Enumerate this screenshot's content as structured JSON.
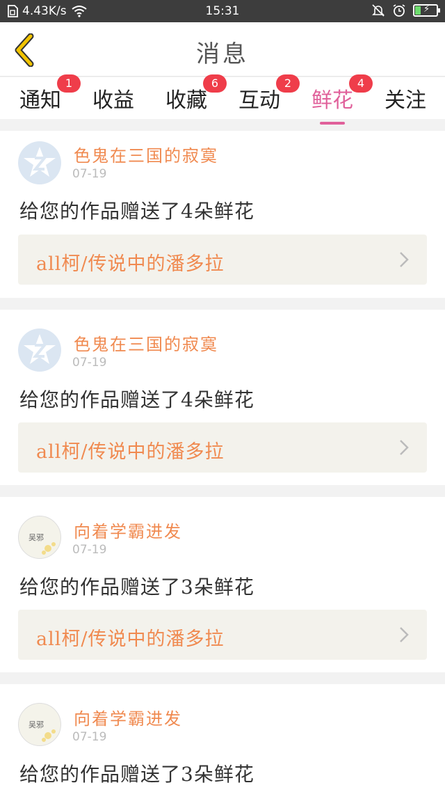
{
  "status_bar": {
    "net_speed": "4.43K/s",
    "time": "15:31",
    "battery_level": 0.25
  },
  "header": {
    "title": "消息"
  },
  "tabs": [
    {
      "label": "通知",
      "badge": "1"
    },
    {
      "label": "收益",
      "badge": ""
    },
    {
      "label": "收藏",
      "badge": "6"
    },
    {
      "label": "互动",
      "badge": "2"
    },
    {
      "label": "鲜花",
      "badge": "4",
      "active": true
    },
    {
      "label": "关注",
      "badge": ""
    }
  ],
  "messages": [
    {
      "user": "色鬼在三国的寂寞",
      "date": "07-19",
      "text": "给您的作品赠送了4朵鲜花",
      "work": "all柯/传说中的潘多拉",
      "avatar": "qq-icon"
    },
    {
      "user": "色鬼在三国的寂寞",
      "date": "07-19",
      "text": "给您的作品赠送了4朵鲜花",
      "work": "all柯/传说中的潘多拉",
      "avatar": "qq-icon"
    },
    {
      "user": "向着学霸进发",
      "date": "07-19",
      "text": "给您的作品赠送了3朵鲜花",
      "work": "all柯/传说中的潘多拉",
      "avatar": "flower-avatar",
      "avatar_text": "吴邪"
    },
    {
      "user": "向着学霸进发",
      "date": "07-19",
      "text": "给您的作品赠送了3朵鲜花",
      "work": "",
      "avatar": "flower-avatar",
      "avatar_text": "吴邪"
    }
  ],
  "colors": {
    "accent": "#e0609a",
    "username": "#f08a50",
    "badge": "#ef3d4a",
    "back_arrow": "#f2c400"
  }
}
